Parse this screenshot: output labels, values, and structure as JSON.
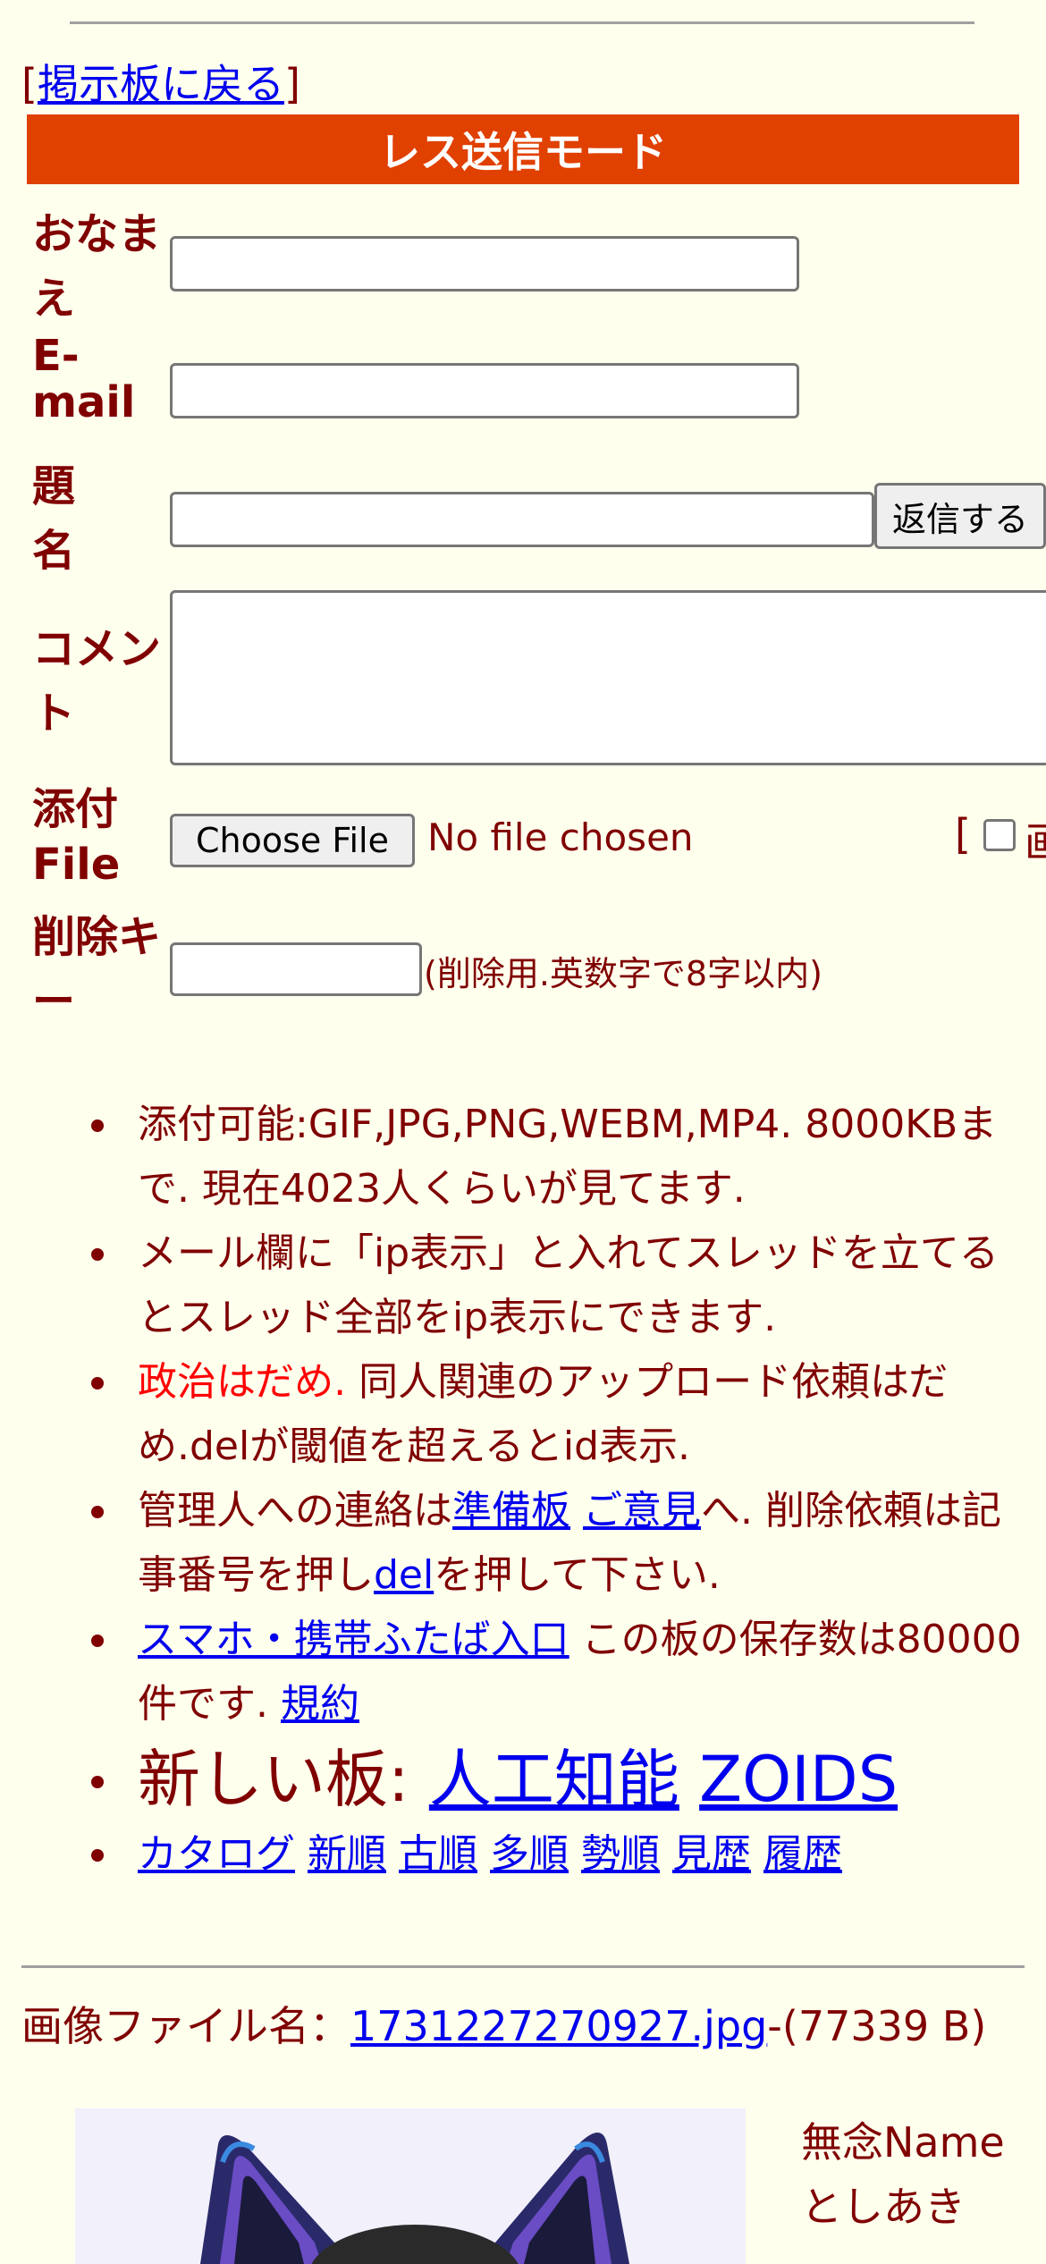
{
  "nav": {
    "back_open": "[",
    "back_link": "掲示板に戻る",
    "back_close": "]"
  },
  "mode_title": "レス送信モード",
  "form": {
    "name_label": "おなまえ",
    "email_label": "E-mail",
    "subject_label": "題名",
    "comment_label": "コメント",
    "file_label": "添付File",
    "delkey_label": "削除キー",
    "submit_button": "返信する",
    "choose_file_button": "Choose File",
    "no_file_text": "No file chosen",
    "right_bracket": "[",
    "trail_glyph": "画",
    "delkey_hint": "(削除用.英数字で8字以内)"
  },
  "notes": {
    "n1": "添付可能:GIF,JPG,PNG,WEBM,MP4. 8000KBまで. 現在4023人くらいが見てます.",
    "n2": "メール欄に「ip表示」と入れてスレッドを立てるとスレッド全部をip表示にできます.",
    "n3_red": "政治はだめ.",
    "n3_rest": " 同人関連のアップロード依頼はだめ.delが閾値を超えるとid表示.",
    "n4_pre": "管理人への連絡は",
    "n4_link1": "準備板",
    "n4_link2": "ご意見",
    "n4_mid": "へ. 削除依頼は記事番号を押し",
    "n4_link3": "del",
    "n4_post": "を押して下さい.",
    "n5_link": "スマホ・携帯ふたば入口",
    "n5_mid": " この板の保存数は80000件です. ",
    "n5_link2": "規約",
    "n6_pre": "新しい板: ",
    "n6_link1": "人工知能",
    "n6_link2": "ZOIDS",
    "sort_links": [
      "カタログ",
      "新順",
      "古順",
      "多順",
      "勢順",
      "見歴",
      "履歴"
    ]
  },
  "post": {
    "file_prefix": "画像ファイル名：",
    "file_name": "1731227270927.jpg",
    "file_size": "-(77339 B)",
    "name_line1": "無念Name",
    "name_line2": "としあき"
  }
}
